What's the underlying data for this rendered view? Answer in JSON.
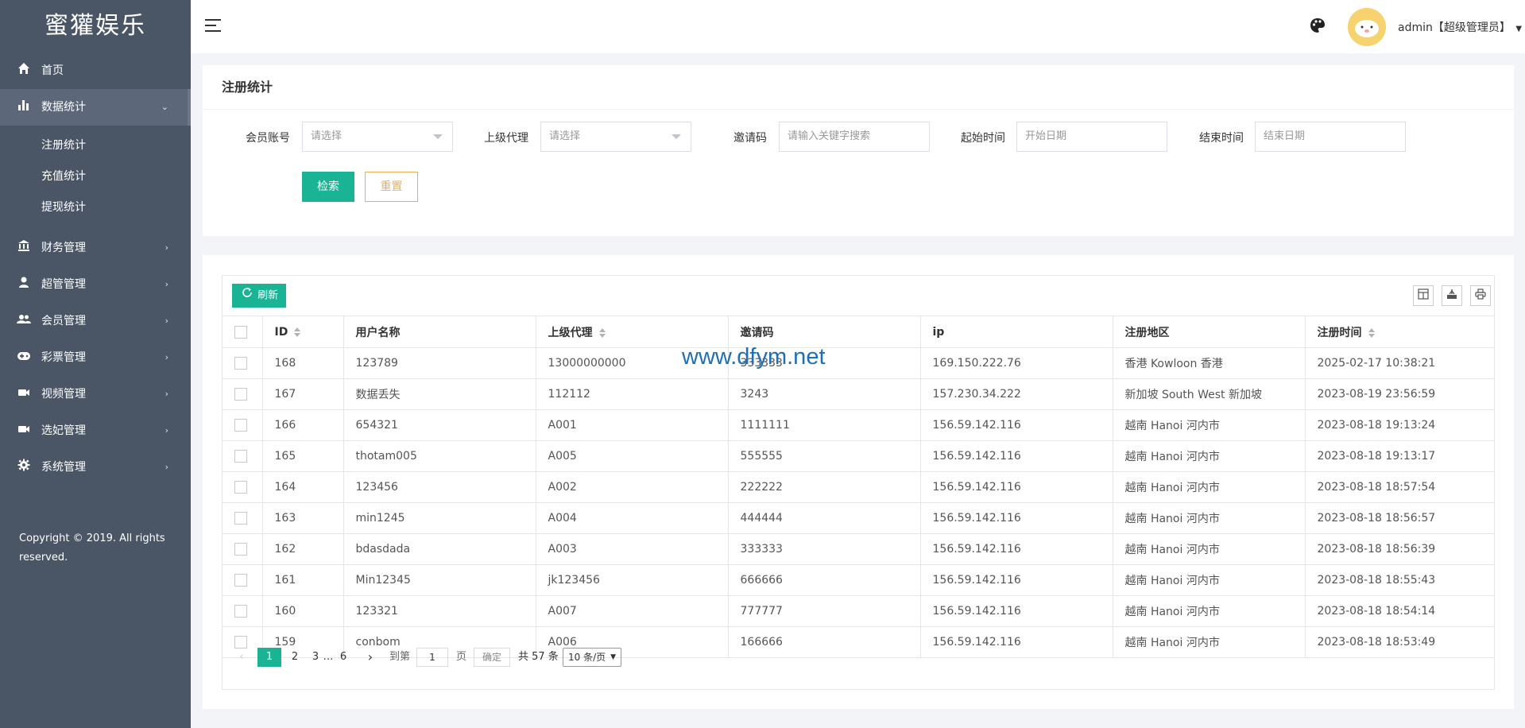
{
  "sidebar": {
    "logo": "蜜獾娱乐",
    "menu": [
      {
        "label": "首页",
        "icon": "home-icon"
      },
      {
        "label": "数据统计",
        "icon": "bar-chart-icon",
        "active": true,
        "sub": [
          "注册统计",
          "充值统计",
          "提现统计"
        ]
      },
      {
        "label": "财务管理",
        "icon": "bank-icon"
      },
      {
        "label": "超管管理",
        "icon": "user-icon"
      },
      {
        "label": "会员管理",
        "icon": "users-icon"
      },
      {
        "label": "彩票管理",
        "icon": "gamepad-icon"
      },
      {
        "label": "视频管理",
        "icon": "video-icon"
      },
      {
        "label": "选妃管理",
        "icon": "camera-icon"
      },
      {
        "label": "系统管理",
        "icon": "gear-icon"
      }
    ],
    "copyright": "Copyright © 2019. All rights reserved."
  },
  "header": {
    "user": "admin【超级管理员】"
  },
  "filter": {
    "title": "注册统计",
    "fields": [
      {
        "label": "会员账号",
        "placeholder": "请选择",
        "type": "select"
      },
      {
        "label": "上级代理",
        "placeholder": "请选择",
        "type": "select"
      },
      {
        "label": "邀请码",
        "placeholder": "请输入关键字搜索",
        "type": "input"
      },
      {
        "label": "起始时间",
        "placeholder": "开始日期",
        "type": "input"
      },
      {
        "label": "结束时间",
        "placeholder": "结束日期",
        "type": "input"
      }
    ],
    "search_label": "检索",
    "reset_label": "重置"
  },
  "table": {
    "refresh_label": "刷新",
    "columns": [
      "ID",
      "用户名称",
      "上级代理",
      "邀请码",
      "ip",
      "注册地区",
      "注册时间"
    ],
    "rows": [
      [
        "168",
        "123789",
        "13000000000",
        "333333",
        "169.150.222.76",
        "香港 Kowloon 香港",
        "2025-02-17 10:38:21"
      ],
      [
        "167",
        "数据丢失",
        "112112",
        "3243",
        "157.230.34.222",
        "新加坡 South West 新加坡",
        "2023-08-19 23:56:59"
      ],
      [
        "166",
        "654321",
        "A001",
        "1111111",
        "156.59.142.116",
        "越南 Hanoi 河内市",
        "2023-08-18 19:13:24"
      ],
      [
        "165",
        "thotam005",
        "A005",
        "555555",
        "156.59.142.116",
        "越南 Hanoi 河内市",
        "2023-08-18 19:13:17"
      ],
      [
        "164",
        "123456",
        "A002",
        "222222",
        "156.59.142.116",
        "越南 Hanoi 河内市",
        "2023-08-18 18:57:54"
      ],
      [
        "163",
        "min1245",
        "A004",
        "444444",
        "156.59.142.116",
        "越南 Hanoi 河内市",
        "2023-08-18 18:56:57"
      ],
      [
        "162",
        "bdasdada",
        "A003",
        "333333",
        "156.59.142.116",
        "越南 Hanoi 河内市",
        "2023-08-18 18:56:39"
      ],
      [
        "161",
        "Min12345",
        "jk123456",
        "666666",
        "156.59.142.116",
        "越南 Hanoi 河内市",
        "2023-08-18 18:55:43"
      ],
      [
        "160",
        "123321",
        "A007",
        "777777",
        "156.59.142.116",
        "越南 Hanoi 河内市",
        "2023-08-18 18:54:14"
      ],
      [
        "159",
        "conbom",
        "A006",
        "166666",
        "156.59.142.116",
        "越南 Hanoi 河内市",
        "2023-08-18 18:53:49"
      ]
    ]
  },
  "pagination": {
    "pages": [
      "1",
      "2",
      "3",
      "…",
      "6"
    ],
    "current": "1",
    "goto_label": "到第",
    "goto_value": "1",
    "page_unit": "页",
    "confirm_label": "确定",
    "total": "共 57 条",
    "page_size": "10 条/页"
  },
  "watermark": "www.dfym.net"
}
